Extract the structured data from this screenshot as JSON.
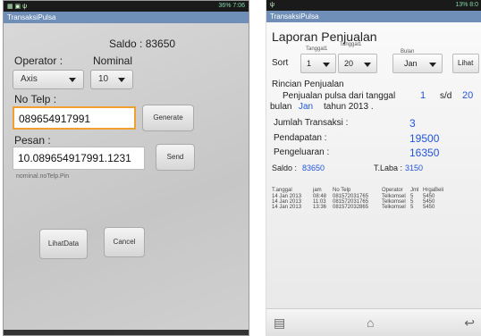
{
  "left": {
    "status": {
      "icons": "▦ ▣ ψ",
      "right": "36% 7:06"
    },
    "title": "TransaksiPulsa",
    "saldo": "Saldo : 83650",
    "operator_label": "Operator :",
    "nominal_label": "Nominal",
    "operator_value": "Axis",
    "nominal_value": "10",
    "notelp_label": "No Telp :",
    "notelp_value": "089654917991",
    "generate_label": "Generate",
    "pesan_label": "Pesan :",
    "pesan_value": "10.089654917991.1231",
    "send_label": "Send",
    "hint": "nominal.noTelp.Pin",
    "lihatdata_label": "LihatData",
    "cancel_label": "Cancel"
  },
  "right": {
    "status": {
      "icons": "ψ",
      "right": "13% 8:0"
    },
    "title": "TransaksiPulsa",
    "heading": "Laporan Penjualan",
    "col_tanggal1": "Tanggal1",
    "col_tanggal1b": "Tanggal1",
    "col_bulan": "Bulan",
    "sort_label": "Sort",
    "sort_tgl1": "1",
    "sort_tgl2": "20",
    "sort_bulan": "Jan",
    "lihat_label": "Lihat",
    "rincian": "Rincian Penjualan",
    "desc_a": "Penjualan pulsa dari tanggal",
    "desc_from": "1",
    "desc_sd": "s/d",
    "desc_to": "20",
    "desc_bulan": "bulan",
    "desc_bulan_val": "Jan",
    "desc_tahun": "tahun 2013 .",
    "jumlah_label": "Jumlah Transaksi :",
    "jumlah_val": "3",
    "pendapatan_label": "Pendapatan :",
    "pendapatan_val": "19500",
    "pengeluaran_label": "Pengeluaran :",
    "pengeluaran_val": "16350",
    "saldo_label": "Saldo :",
    "saldo_val": "83650",
    "laba_label": "T.Laba :",
    "laba_val": "3150",
    "table_header": [
      "T.anggal",
      "jam",
      "No Telp",
      "Operator",
      "Jml",
      "HrgaBeli"
    ],
    "table_rows": [
      [
        "14 Jan 2013",
        "08:48",
        "081572031765",
        "Telkomsel",
        "5",
        "5450"
      ],
      [
        "14 Jan 2013",
        "11:03",
        "081572031765",
        "Telkomsel",
        "5",
        "5450"
      ],
      [
        "14 Jan 2013",
        "13:36",
        "081572032865",
        "Telkomsel",
        "5",
        "5450"
      ]
    ]
  }
}
